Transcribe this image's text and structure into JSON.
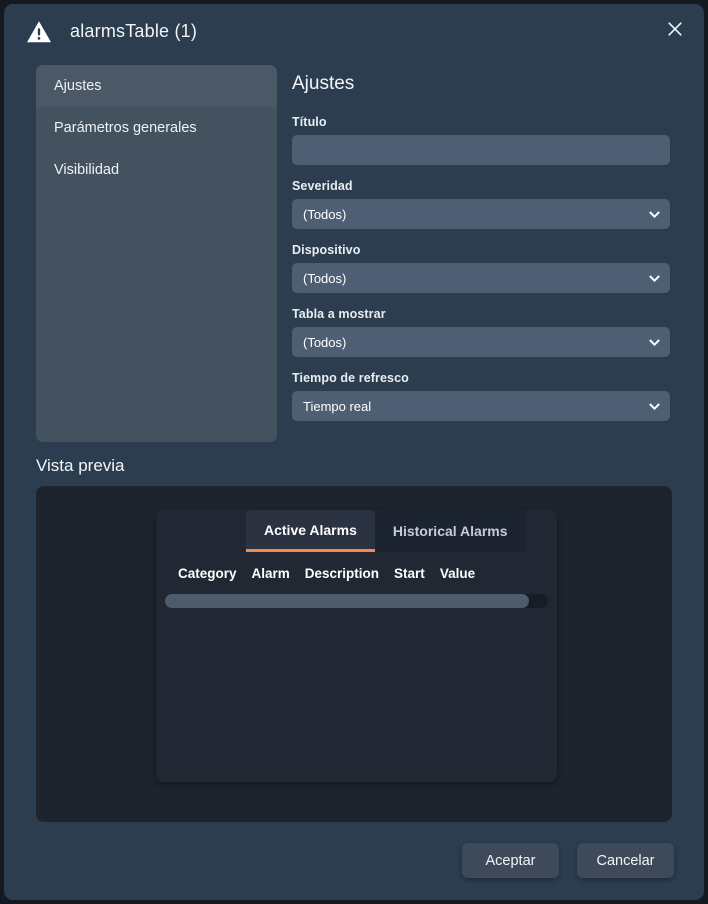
{
  "colors": {
    "page_background": "#151a20",
    "dialog_background": "#2b3d4e",
    "sidebar_background": "#44515f",
    "input_background": "#4e5f73",
    "preview_background": "#1e242e",
    "widget_background": "#212834",
    "accent_orange": "#ef8a4a",
    "button_background": "#3e4a59"
  },
  "titlebar": {
    "icon": "warning-triangle-icon",
    "title": "alarmsTable (1)",
    "close_icon": "close-icon"
  },
  "sidebar": {
    "items": [
      {
        "label": "Ajustes",
        "selected": true
      },
      {
        "label": "Parámetros generales",
        "selected": false
      },
      {
        "label": "Visibilidad",
        "selected": false
      }
    ]
  },
  "settings": {
    "section_title": "Ajustes",
    "fields": [
      {
        "label": "Título",
        "type": "text",
        "value": "",
        "placeholder": ""
      },
      {
        "label": "Severidad",
        "type": "select",
        "value": "(Todos)"
      },
      {
        "label": "Dispositivo",
        "type": "select",
        "value": "(Todos)"
      },
      {
        "label": "Tabla a mostrar",
        "type": "select",
        "value": "(Todos)"
      },
      {
        "label": "Tiempo de refresco",
        "type": "select",
        "value": "Tiempo real"
      }
    ]
  },
  "preview": {
    "heading": "Vista previa",
    "widget": {
      "tabs": [
        {
          "label": "Active Alarms",
          "active": true
        },
        {
          "label": "Historical Alarms",
          "active": false
        }
      ],
      "table_headers": [
        "Category",
        "Alarm",
        "Description",
        "Start",
        "Value"
      ],
      "table_rows": [],
      "horizontal_scrollbar": {
        "thumb_percent": 95
      }
    }
  },
  "footer": {
    "accept_label": "Aceptar",
    "cancel_label": "Cancelar"
  }
}
